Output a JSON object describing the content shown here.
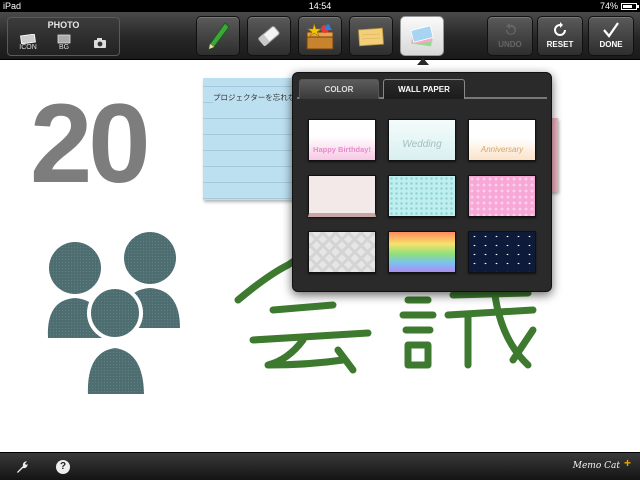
{
  "status_bar": {
    "device": "iPad",
    "time": "14:54",
    "battery": "74%",
    "battery_level": 0.74
  },
  "photo": {
    "title": "PHOTO",
    "icon_label": "ICON",
    "bg_label": "BG"
  },
  "tools": {
    "pen_icon": "pencil-icon",
    "eraser_icon": "eraser-icon",
    "stamp_icon": "stamp-box-icon",
    "memo_icon": "sticky-note-icon",
    "paper_icon": "wallpaper-stack-icon"
  },
  "actions": {
    "undo_label": "UNDO",
    "reset_label": "RESET",
    "done_label": "DONE"
  },
  "canvas": {
    "big_number": "20",
    "sticky_text": "プロジェクターを忘れないように",
    "close_mark": "×"
  },
  "popup": {
    "tab_color": "COLOR",
    "tab_wallpaper": "WALL PAPER",
    "selected_tab": "WALL PAPER",
    "thumbnails": [
      {
        "label": "Happy Birthday!"
      },
      {
        "label": "Wedding"
      },
      {
        "label": "Anniversary"
      },
      {
        "label": ""
      },
      {
        "label": ""
      },
      {
        "label": ""
      },
      {
        "label": ""
      },
      {
        "label": ""
      },
      {
        "label": ""
      }
    ]
  },
  "bottom_bar": {
    "help_label": "?",
    "logo_text": "Memo Cat",
    "logo_plus": "+"
  },
  "colors": {
    "ink_green": "#3d7a2f",
    "people_teal": "#4e6d70",
    "number_gray": "#7d7d7d",
    "accent_orange": "#f2a000"
  }
}
